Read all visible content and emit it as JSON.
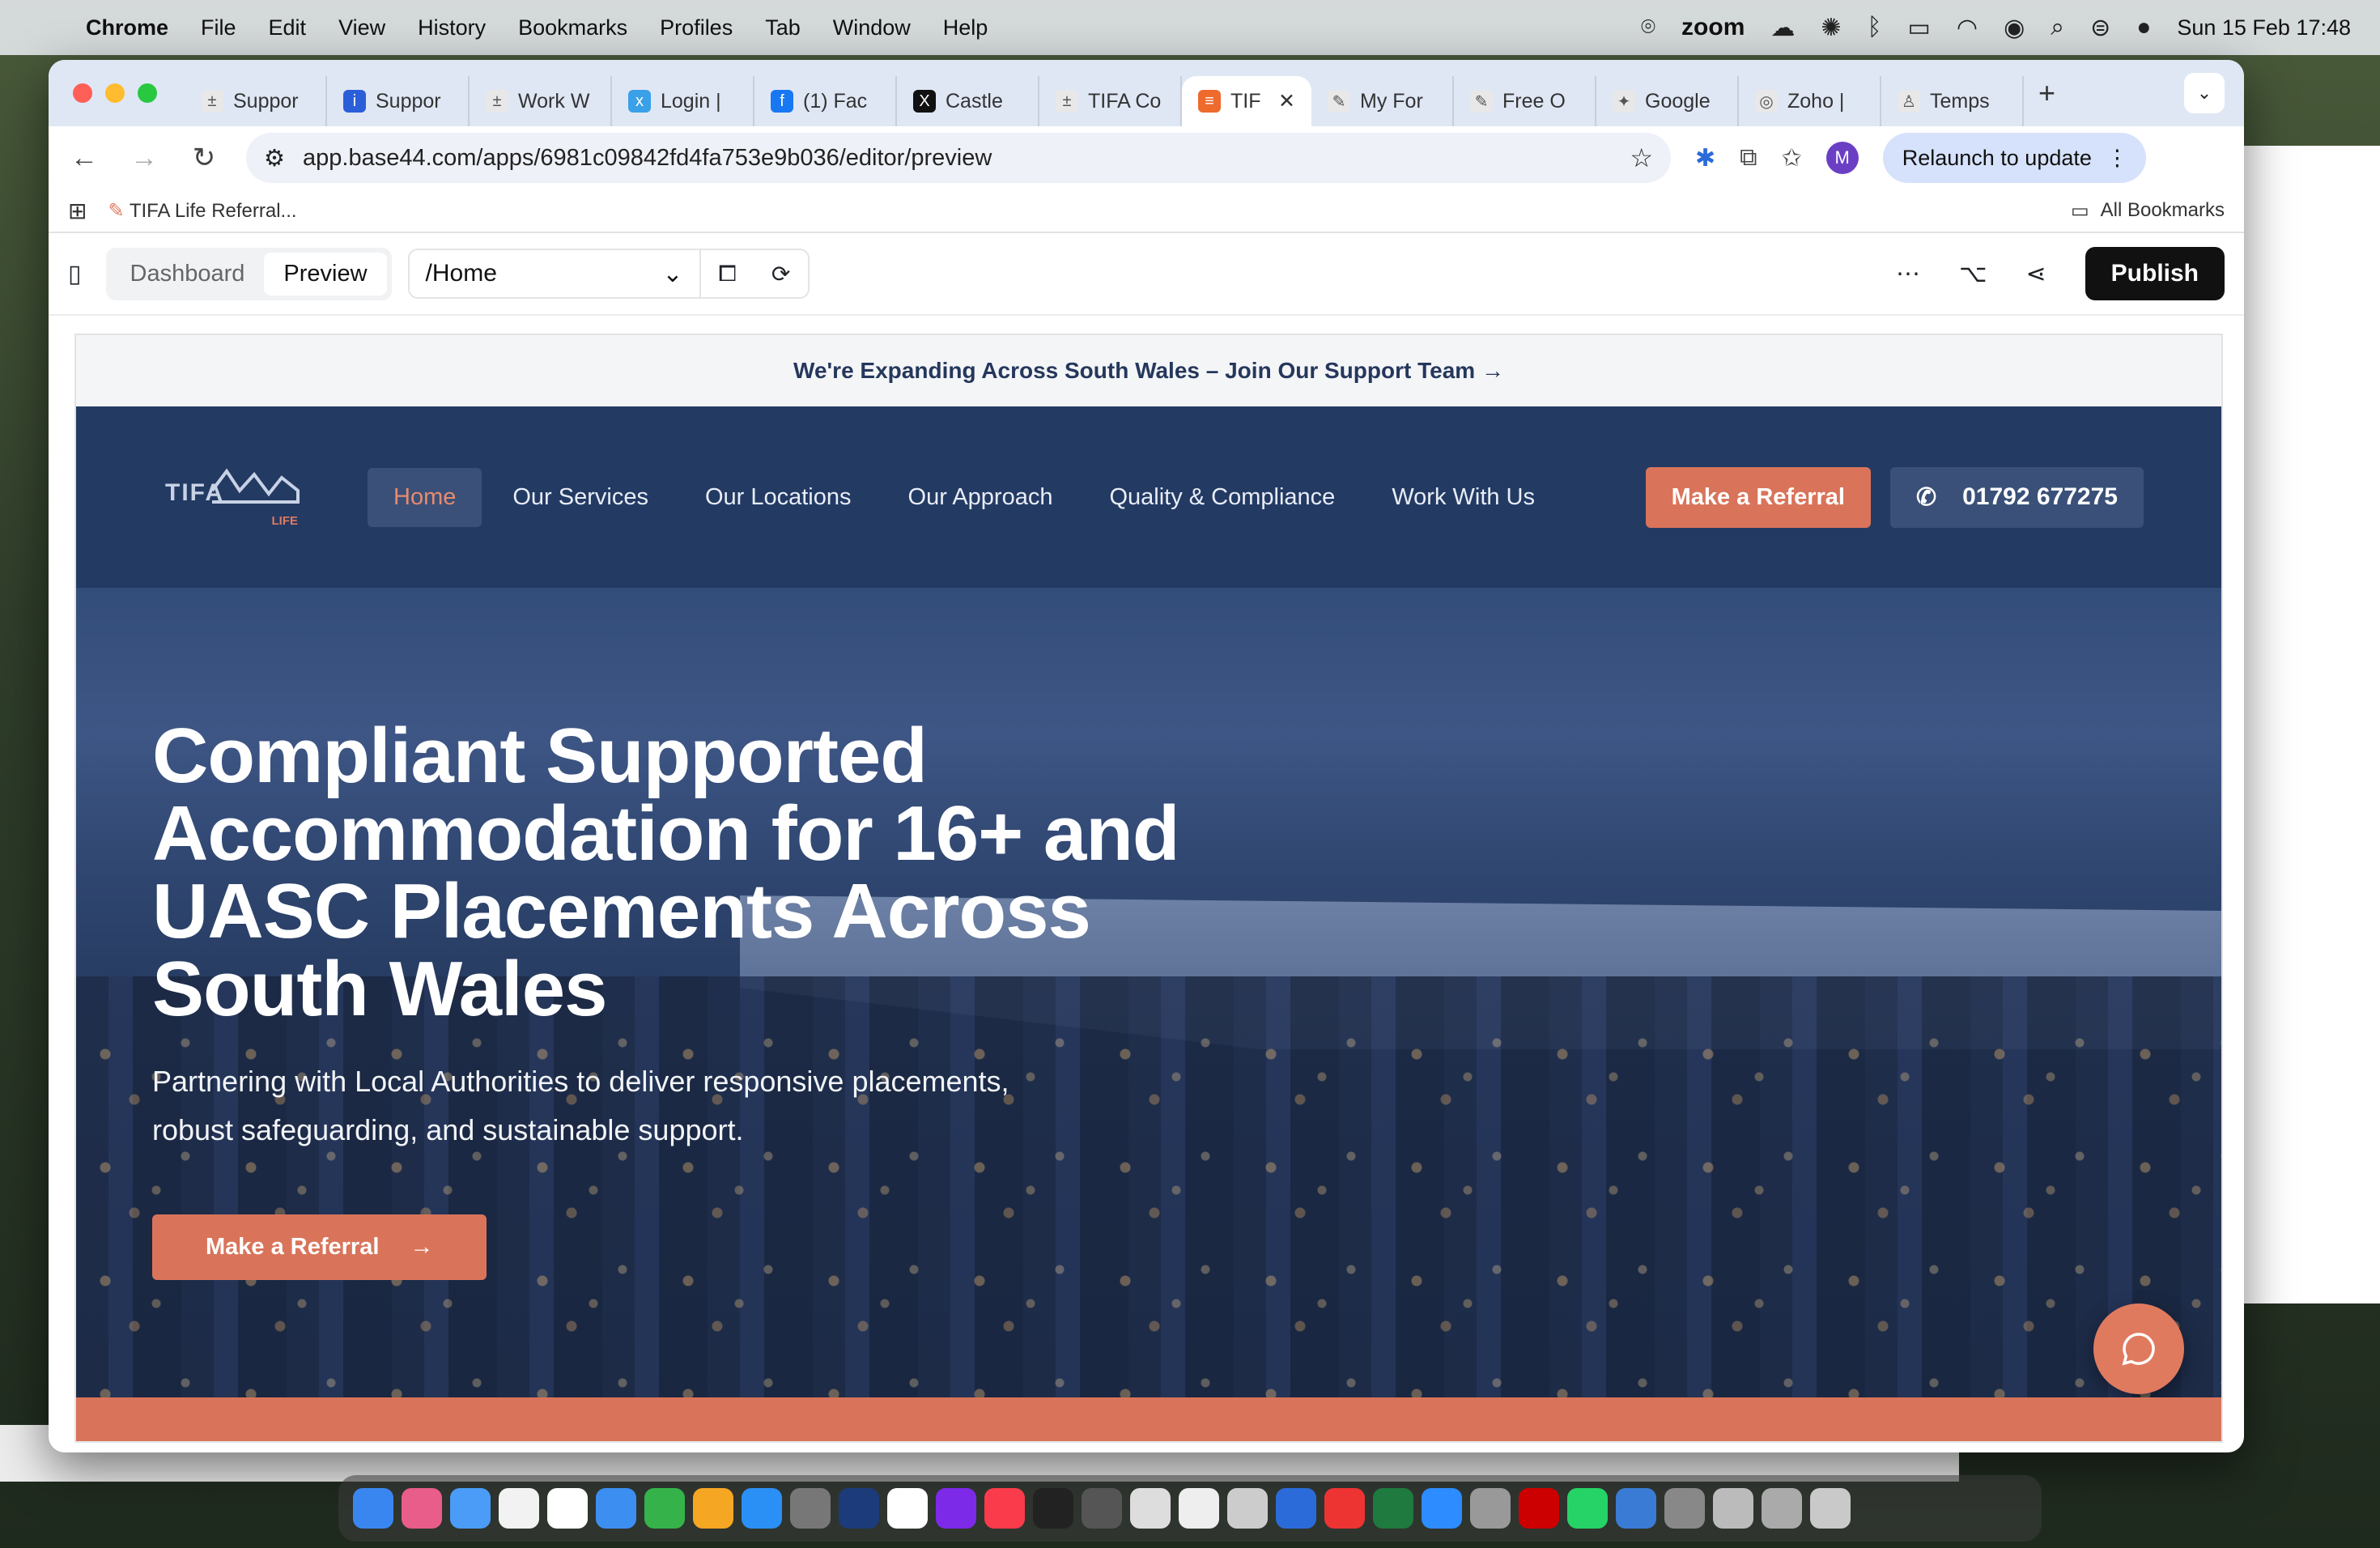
{
  "menubar": {
    "app": "Chrome",
    "items": [
      "File",
      "Edit",
      "View",
      "History",
      "Bookmarks",
      "Profiles",
      "Tab",
      "Window",
      "Help"
    ],
    "zoom": "zoom",
    "datetime": "Sun 15 Feb 17:48"
  },
  "tabs": [
    {
      "label": "Suppor",
      "color": "#e8e8e8",
      "glyph": "±"
    },
    {
      "label": "Suppor",
      "color": "#2b5fd9",
      "glyph": "i"
    },
    {
      "label": "Work W",
      "color": "#e8e8e8",
      "glyph": "±"
    },
    {
      "label": "Login |",
      "color": "#3aa0e8",
      "glyph": "x"
    },
    {
      "label": "(1) Fac",
      "color": "#1877f2",
      "glyph": "f"
    },
    {
      "label": "Castle",
      "color": "#111111",
      "glyph": "X"
    },
    {
      "label": "TIFA Co",
      "color": "#e8e8e8",
      "glyph": "±"
    },
    {
      "label": "TIF",
      "color": "#ee6a2d",
      "glyph": "≡",
      "active": true
    },
    {
      "label": "My For",
      "color": "#e8e8e8",
      "glyph": "✎"
    },
    {
      "label": "Free O",
      "color": "#e8e8e8",
      "glyph": "✎"
    },
    {
      "label": "Google",
      "color": "#e8e8e8",
      "glyph": "✦"
    },
    {
      "label": "Zoho |",
      "color": "#e8e8e8",
      "glyph": "◎"
    },
    {
      "label": "Temps",
      "color": "#e8e8e8",
      "glyph": "♙"
    }
  ],
  "browser": {
    "url": "app.base44.com/apps/6981c09842fd4fa753e9b036/editor/preview",
    "relaunch": "Relaunch to update",
    "avatar": "M",
    "bookmark1": "TIFA Life Referral...",
    "all_bookmarks": "All Bookmarks"
  },
  "editor": {
    "dashboard": "Dashboard",
    "preview": "Preview",
    "route": "/Home",
    "publish": "Publish"
  },
  "site": {
    "announcement": "We're Expanding Across South Wales – Join Our Support Team →",
    "logo_text": "TIFA",
    "logo_sub": "LIFE",
    "nav": [
      "Home",
      "Our Services",
      "Our Locations",
      "Our Approach",
      "Quality & Compliance",
      "Work With Us"
    ],
    "referral": "Make a Referral",
    "phone": "01792 677275",
    "hero_title": "Compliant Supported Accommodation for 16+ and UASC Placements Across South Wales",
    "hero_sub": "Partnering with Local Authorities to deliver responsive placements, robust safeguarding, and sustainable support.",
    "hero_cta": "Make a Referral"
  },
  "colors": {
    "navy": "#233a63",
    "accent": "#d9745a"
  }
}
